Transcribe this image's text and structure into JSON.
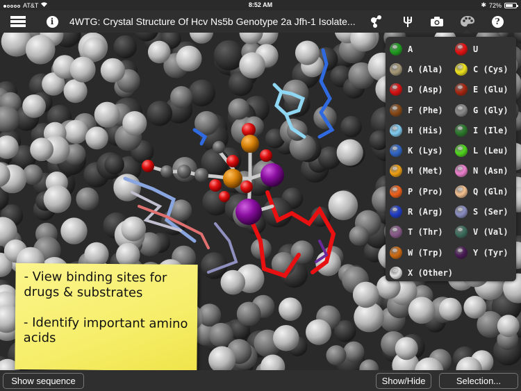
{
  "status_bar": {
    "carrier": "AT&T",
    "time": "8:52 AM",
    "battery": "72%",
    "battery_level": 0.72,
    "signal_bars_filled": 1,
    "signal_bars_total": 5
  },
  "toolbar": {
    "title": "4WTG: Crystal Structure Of Hcv Ns5b Genotype 2a Jfh-1 Isolate...",
    "icons": [
      "menu-icon",
      "info-icon",
      "molecule-icon",
      "tuning-fork-icon",
      "camera-icon",
      "palette-icon",
      "help-icon"
    ],
    "info_glyph": "i",
    "help_glyph": "?"
  },
  "sticky_note": {
    "line1": "- View binding sites for drugs & substrates",
    "line2": "- Identify important amino acids"
  },
  "legend": {
    "items": [
      {
        "label": "A",
        "color": "#1fa01f"
      },
      {
        "label": "U",
        "color": "#e81010"
      },
      {
        "label": "A (Ala)",
        "color": "#a79a78"
      },
      {
        "label": "C (Cys)",
        "color": "#f2e61a"
      },
      {
        "label": "D (Asp)",
        "color": "#dd1010"
      },
      {
        "label": "E (Glu)",
        "color": "#a8260f"
      },
      {
        "label": "F (Phe)",
        "color": "#8a4a16"
      },
      {
        "label": "G (Gly)",
        "color": "#8a8a8a"
      },
      {
        "label": "H (His)",
        "color": "#80ccf2"
      },
      {
        "label": "I (Ile)",
        "color": "#2a7a2a"
      },
      {
        "label": "K (Lys)",
        "color": "#2f66c9"
      },
      {
        "label": "L (Leu)",
        "color": "#4ed81a"
      },
      {
        "label": "M (Met)",
        "color": "#efa012"
      },
      {
        "label": "N (Asn)",
        "color": "#ef7fcf"
      },
      {
        "label": "P (Pro)",
        "color": "#f06018"
      },
      {
        "label": "Q (Gln)",
        "color": "#f5c08e"
      },
      {
        "label": "R (Arg)",
        "color": "#1f3cc9"
      },
      {
        "label": "S (Ser)",
        "color": "#8a8ec2"
      },
      {
        "label": "T (Thr)",
        "color": "#8a5a8a"
      },
      {
        "label": "V (Val)",
        "color": "#3c6e5c"
      },
      {
        "label": "W (Trp)",
        "color": "#cf6a10"
      },
      {
        "label": "Y (Tyr)",
        "color": "#4a1a56"
      },
      {
        "label": "X (Other)",
        "color": "#e4e4e4"
      }
    ]
  },
  "bottom_bar": {
    "show_sequence": "Show sequence",
    "show_hide": "Show/Hide",
    "selection": "Selection..."
  }
}
